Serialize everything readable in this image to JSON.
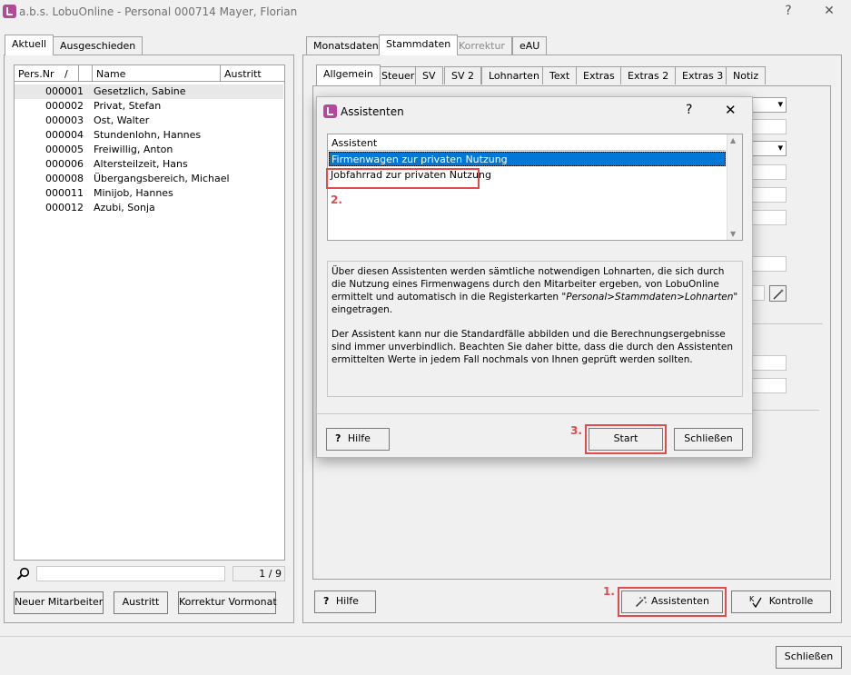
{
  "window": {
    "title": "a.b.s. LobuOnline - Personal 000714 Mayer, Florian",
    "help_glyph": "?",
    "close_glyph": "✕"
  },
  "left_tabs": [
    "Aktuell",
    "Ausgeschieden"
  ],
  "employee_list": {
    "columns": [
      "Pers.Nr",
      "/",
      "Name",
      "Austritt"
    ],
    "rows": [
      {
        "nr": "000001",
        "name": "Gesetzlich, Sabine"
      },
      {
        "nr": "000002",
        "name": "Privat, Stefan"
      },
      {
        "nr": "000003",
        "name": "Ost, Walter"
      },
      {
        "nr": "000004",
        "name": "Stundenlohn, Hannes"
      },
      {
        "nr": "000005",
        "name": "Freiwillig, Anton"
      },
      {
        "nr": "000006",
        "name": "Altersteilzeit, Hans"
      },
      {
        "nr": "000008",
        "name": "Übergangsbereich, Michael"
      },
      {
        "nr": "000011",
        "name": "Minijob, Hannes"
      },
      {
        "nr": "000012",
        "name": "Azubi, Sonja"
      }
    ],
    "search_value": "",
    "counter": "1 / 9"
  },
  "left_buttons": {
    "new": "Neuer Mitarbeiter",
    "exit": "Austritt",
    "correction": "Korrektur Vormonat"
  },
  "main_tabs": [
    {
      "label": "Monatsdaten",
      "state": "normal"
    },
    {
      "label": "Stammdaten",
      "state": "active"
    },
    {
      "label": "Korrektur",
      "state": "disabled"
    },
    {
      "label": "eAU",
      "state": "normal"
    }
  ],
  "sub_tabs": [
    "Allgemein",
    "Steuer",
    "SV",
    "SV 2",
    "Lohnarten",
    "Text",
    "Extras",
    "Extras 2",
    "Extras 3",
    "Notiz"
  ],
  "bottom_buttons": {
    "help": "Hilfe",
    "assistants": "Assistenten",
    "check": "Kontrolle",
    "close": "Schließen",
    "help_glyph": "?"
  },
  "annotations": {
    "one": "1.",
    "two": "2.",
    "three": "3."
  },
  "dialog": {
    "title": "Assistenten",
    "help_glyph": "?",
    "close_glyph": "✕",
    "list_header": "Assistent",
    "items": [
      {
        "label": "Firmenwagen zur privaten Nutzung",
        "selected": true
      },
      {
        "label": "Jobfahrrad zur privaten Nutzung",
        "selected": false
      }
    ],
    "desc_p1_a": "Über diesen Assistenten werden sämtliche notwendigen Lohnarten, die sich durch die Nutzung eines Firmenwagens durch den Mitarbeiter ergeben, von LobuOnline ermittelt und automatisch in die Registerkarten ",
    "desc_p1_em": "\"Personal>Stammdaten>Lohnarten\"",
    "desc_p1_b": " eingetragen.",
    "desc_p2": "Der Assistent kann nur die Standardfälle abbilden und die Berechnungsergebnisse sind immer unverbindlich. Beachten Sie daher bitte, dass die durch den Assistenten ermittelten Werte in jedem Fall nochmals von Ihnen geprüft werden sollten.",
    "help_label": "Hilfe",
    "start_label": "Start",
    "close_label": "Schließen"
  },
  "colors": {
    "accent": "#0078d7",
    "highlight": "#e24b4b",
    "logo": "#b4489a"
  },
  "icons": [
    "app-logo-icon",
    "search-icon",
    "wand-icon",
    "check-icon",
    "help-icon",
    "close-icon"
  ]
}
